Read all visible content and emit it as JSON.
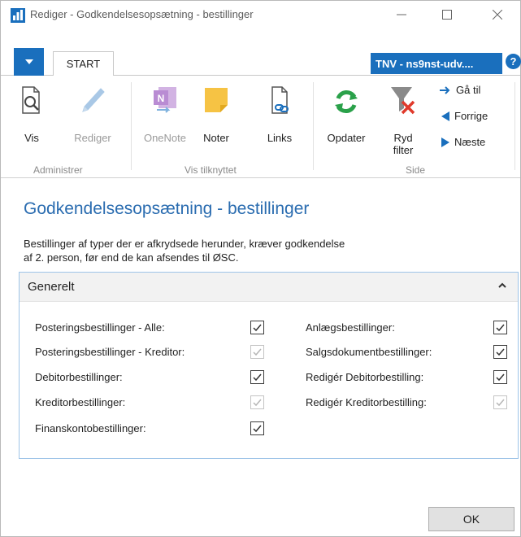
{
  "window": {
    "title": "Rediger - Godkendelsesopsætning - bestillinger"
  },
  "ribbon": {
    "tab_start": "START",
    "company": "TNV - ns9nst-udv....",
    "help": "?",
    "groups": [
      {
        "label": "Administrer"
      },
      {
        "label": "Vis tilknyttet"
      },
      {
        "label": "Side"
      }
    ],
    "buttons": {
      "vis": "Vis",
      "rediger": "Rediger",
      "onenote": "OneNote",
      "noter": "Noter",
      "links": "Links",
      "opdater": "Opdater",
      "ryd_filter_1": "Ryd",
      "ryd_filter_2": "filter",
      "ga_til": "Gå til",
      "forrige": "Forrige",
      "naeste": "Næste"
    },
    "icons": {
      "vis": "document-search-icon",
      "rediger": "pencil-icon",
      "onenote": "onenote-icon",
      "noter": "note-icon",
      "links": "document-link-icon",
      "opdater": "refresh-icon",
      "ryd_filter": "clear-filter-icon"
    },
    "colors": {
      "accent": "#1a6fbd",
      "refresh": "#2aa14a",
      "filter_x": "#e0392b",
      "note": "#f6c344",
      "onenote": "#8a3fb0"
    }
  },
  "page": {
    "title": "Godkendelsesopsætning - bestillinger",
    "description_line1": "Bestillinger af typer der er afkrydsede herunder, kræver godkendelse",
    "description_line2": "af 2. person, før end de kan afsendes til ØSC."
  },
  "fasttab": {
    "title": "Generelt",
    "left_fields": [
      {
        "label": "Posteringsbestillinger - Alle:",
        "checked": true,
        "enabled": true
      },
      {
        "label": "Posteringsbestillinger - Kreditor:",
        "checked": true,
        "enabled": false
      },
      {
        "label": "Debitorbestillinger:",
        "checked": true,
        "enabled": true
      },
      {
        "label": "Kreditorbestillinger:",
        "checked": true,
        "enabled": false
      },
      {
        "label": "Finanskontobestillinger:",
        "checked": true,
        "enabled": true
      }
    ],
    "right_fields": [
      {
        "label": "Anlægsbestillinger:",
        "checked": true,
        "enabled": true
      },
      {
        "label": "Salgsdokumentbestillinger:",
        "checked": true,
        "enabled": true
      },
      {
        "label": "Redigér Debitorbestilling:",
        "checked": true,
        "enabled": true
      },
      {
        "label": "Redigér Kreditorbestilling:",
        "checked": true,
        "enabled": false
      }
    ]
  },
  "footer": {
    "ok_label": "OK"
  }
}
